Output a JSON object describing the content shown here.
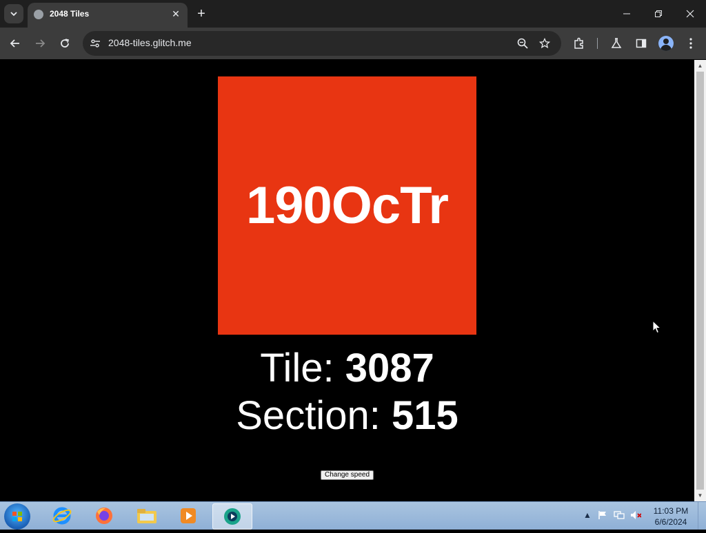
{
  "browser": {
    "tab": {
      "title": "2048 Tiles"
    },
    "address_bar": {
      "url": "2048-tiles.glitch.me"
    }
  },
  "page": {
    "tile": {
      "text": "190OcTr",
      "color": "#e83512"
    },
    "tile_info": {
      "label": "Tile:",
      "value": "3087"
    },
    "section_info": {
      "label": "Section:",
      "value": "515"
    },
    "change_speed_label": "Change speed"
  },
  "taskbar": {
    "apps": [
      "start",
      "internet-explorer",
      "firefox",
      "file-explorer",
      "media-player",
      "chrome-like-app"
    ],
    "clock": {
      "time": "11:03 PM",
      "date": "6/6/2024"
    }
  }
}
